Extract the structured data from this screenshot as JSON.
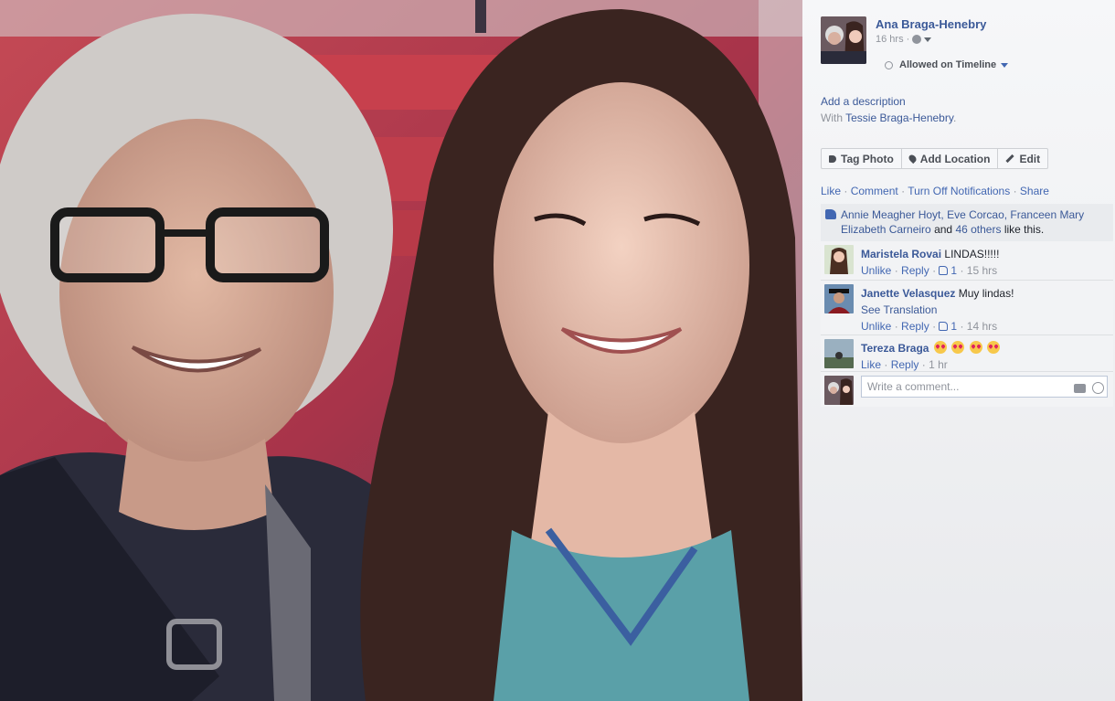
{
  "post": {
    "author": "Ana Braga-Henebry",
    "time": "16 hrs",
    "timeline_status": "Allowed on Timeline",
    "add_description": "Add a description",
    "with_prefix": "With",
    "with_person": "Tessie Braga-Henebry",
    "with_suffix": "."
  },
  "buttons": {
    "tag": "Tag Photo",
    "location": "Add Location",
    "edit": "Edit"
  },
  "actions": {
    "like": "Like",
    "comment": "Comment",
    "notifications": "Turn Off Notifications",
    "share": "Share",
    "separator": "·"
  },
  "likes": {
    "names": "Annie Meagher Hoyt, Eve Corcao, Franceen Mary Elizabeth Carneiro",
    "and": "and",
    "others": "46 others",
    "suffix": "like this."
  },
  "comments": [
    {
      "name": "Maristela Rovai",
      "text": "LINDAS!!!!!",
      "action": "Unlike",
      "reply": "Reply",
      "likes": "1",
      "time": "15 hrs"
    },
    {
      "name": "Janette Velasquez",
      "text": "Muy lindas!",
      "translate": "See Translation",
      "action": "Unlike",
      "reply": "Reply",
      "likes": "1",
      "time": "14 hrs"
    },
    {
      "name": "Tereza Braga",
      "text": "",
      "action": "Like",
      "reply": "Reply",
      "time": "1 hr"
    }
  ],
  "composer": {
    "placeholder": "Write a comment..."
  },
  "colors": {
    "link": "#3b5998",
    "muted": "#90949c",
    "panel": "#f6f7f9"
  }
}
